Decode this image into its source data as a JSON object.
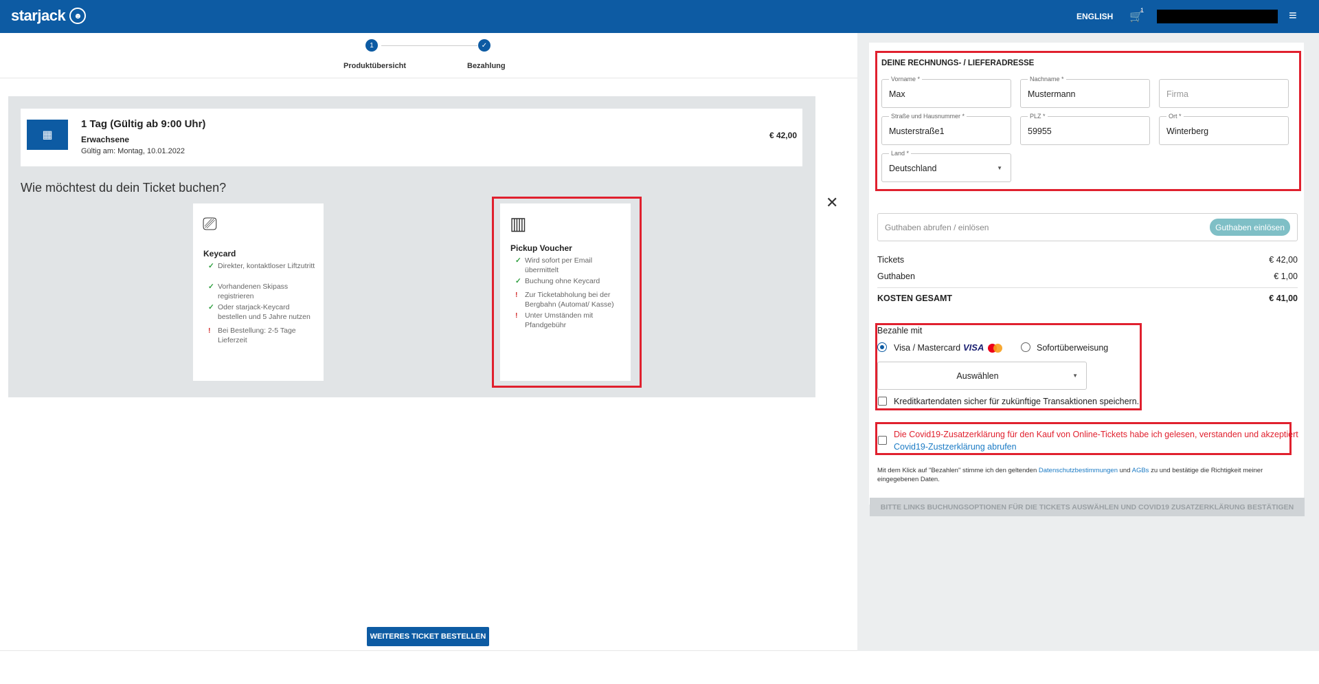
{
  "header": {
    "logo_text": "starjack",
    "language": "ENGLISH",
    "cart_count": "1",
    "menu_icon": "hamburger-icon"
  },
  "stepper": {
    "step1_number": "1",
    "step1_label": "Produktübersicht",
    "step2_label": "Bezahlung"
  },
  "ticket": {
    "title": "1 Tag (Gültig ab 9:00 Uhr)",
    "category": "Erwachsene",
    "valid": "Gültig am: Montag, 10.01.2022",
    "price": "€ 42,00"
  },
  "booking": {
    "question": "Wie möchtest du dein Ticket buchen?",
    "options": [
      {
        "title": "Keycard",
        "icon": "keycard-icon",
        "features": [
          {
            "type": "ok",
            "text": "Direkter, kontaktloser Liftzutritt"
          },
          {
            "type": "ok",
            "text": "Vorhandenen Skipass registrieren"
          },
          {
            "type": "ok",
            "text": "Oder starjack-Keycard bestellen und 5 Jahre nutzen"
          },
          {
            "type": "warn",
            "text": "Bei Bestellung: 2-5 Tage Lieferzeit"
          }
        ]
      },
      {
        "title": "Pickup Voucher",
        "icon": "barcode-voucher-icon",
        "features": [
          {
            "type": "ok",
            "text": "Wird sofort per Email übermittelt"
          },
          {
            "type": "ok",
            "text": "Buchung ohne Keycard"
          },
          {
            "type": "warn",
            "text": "Zur Ticketabholung bei der Bergbahn (Automat/ Kasse)"
          },
          {
            "type": "warn",
            "text": "Unter Umständen mit Pfandgebühr"
          }
        ]
      }
    ],
    "more_button": "WEITERES TICKET BESTELLEN"
  },
  "address": {
    "title": "DEINE RECHNUNGS- / LIEFERADRESSE",
    "firstname_label": "Vorname *",
    "firstname": "Max",
    "lastname_label": "Nachname *",
    "lastname": "Mustermann",
    "company_placeholder": "Firma",
    "street_label": "Straße und Hausnummer *",
    "street": "Musterstraße1",
    "zip_label": "PLZ *",
    "zip": "59955",
    "city_label": "Ort *",
    "city": "Winterberg",
    "country_label": "Land *",
    "country": "Deutschland"
  },
  "credit": {
    "placeholder": "Guthaben abrufen / einlösen",
    "button": "Guthaben einlösen"
  },
  "summary": {
    "tickets_label": "Tickets",
    "tickets_value": "€ 42,00",
    "credit_label": "Guthaben",
    "credit_value": "€ 1,00",
    "total_label": "KOSTEN GESAMT",
    "total_value": "€ 41,00"
  },
  "payment": {
    "title": "Bezahle mit",
    "option1": "Visa / Mastercard",
    "visa_text": "VISA",
    "option2": "Sofortüberweisung",
    "select_value": "Auswählen",
    "save_label": "Kreditkartendaten sicher für zukünftige Transaktionen speichern."
  },
  "covid": {
    "label": "Die Covid19-Zusatzerklärung für den Kauf von Online-Tickets habe ich gelesen, verstanden und akzeptiert",
    "link": "Covid19-Zustzerklärung abrufen"
  },
  "legal": {
    "text1": "Mit dem Klick auf \"Bezahlen\" stimme ich den geltenden",
    "privacy_link": "Datenschutzbestimmungen",
    "and": "und",
    "agb_link": "AGBs",
    "text2": "zu und bestätige die Richtigkeit meiner eingegebenen Daten."
  },
  "submit_label": "BITTE LINKS BUCHUNGSOPTIONEN FÜR DIE TICKETS AUSWÄHLEN UND COVID19 ZUSATZERKLÄRUNG BESTÄTIGEN",
  "colors": {
    "brand": "#0d5ba3",
    "highlight": "#e0202e",
    "ok": "#2e9e3e",
    "warn": "#d32f2f"
  }
}
